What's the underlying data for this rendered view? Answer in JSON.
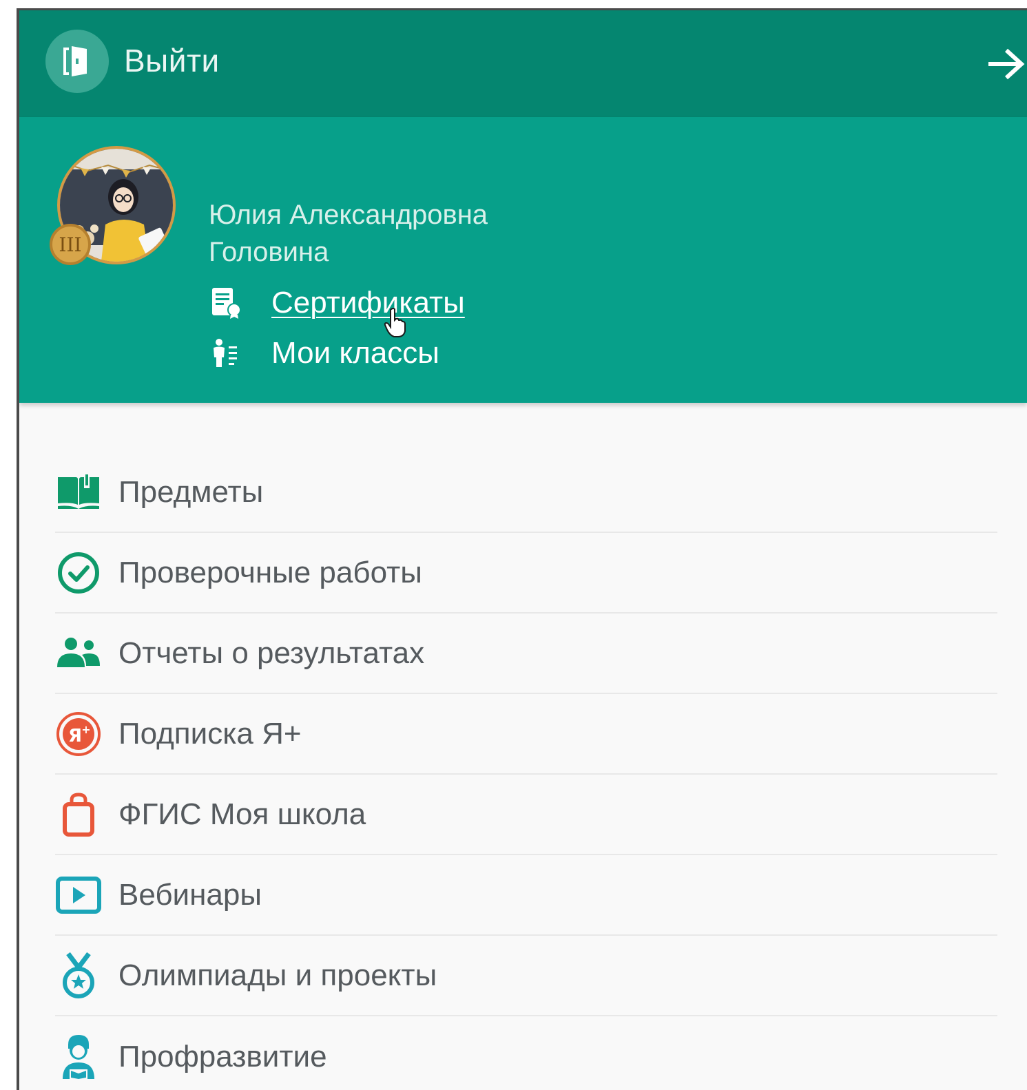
{
  "header": {
    "logout_label": "Выйти"
  },
  "profile": {
    "name_line1": "Юлия Александровна",
    "name_line2": "Головина",
    "badge": "III",
    "links": {
      "certificates": "Сертификаты",
      "my_classes": "Мои классы"
    }
  },
  "menu": {
    "items": [
      {
        "label": "Предметы",
        "icon": "book-icon"
      },
      {
        "label": "Проверочные работы",
        "icon": "check-circle-icon"
      },
      {
        "label": "Отчеты о результатах",
        "icon": "users-icon"
      },
      {
        "label": "Подписка Я+",
        "icon": "ya-plus-icon"
      },
      {
        "label": "ФГИС Моя школа",
        "icon": "shopping-bag-icon"
      },
      {
        "label": "Вебинары",
        "icon": "play-screen-icon"
      },
      {
        "label": "Олимпиады и проекты",
        "icon": "medal-icon"
      },
      {
        "label": "Профразвитие",
        "icon": "teacher-icon"
      }
    ]
  },
  "colors": {
    "header_bg": "#058670",
    "profile_bg": "#07a08a",
    "green_icon": "#0f9a6a",
    "orange_icon": "#e8573a",
    "teal_icon": "#1ba5b8",
    "menu_text": "#555a5e"
  }
}
